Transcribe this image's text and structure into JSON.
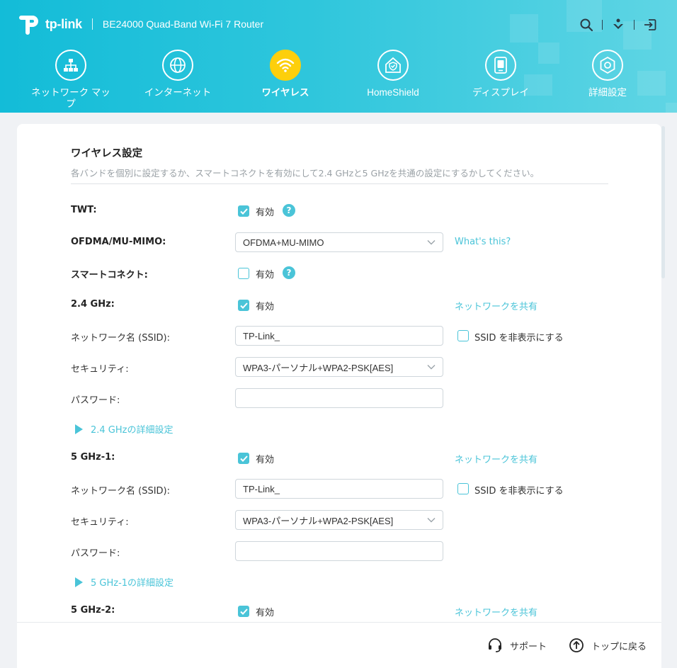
{
  "header": {
    "logo_text": "tp-link",
    "model": "BE24000 Quad-Band Wi-Fi 7 Router",
    "accent_color": "#13bcd8"
  },
  "nav": {
    "items": [
      {
        "label": "ネットワーク マップ",
        "icon": "network-map-icon"
      },
      {
        "label": "インターネット",
        "icon": "globe-icon"
      },
      {
        "label": "ワイヤレス",
        "icon": "wifi-icon",
        "active": true
      },
      {
        "label": "HomeShield",
        "icon": "homeshield-icon"
      },
      {
        "label": "ディスプレイ",
        "icon": "display-icon"
      },
      {
        "label": "詳細設定",
        "icon": "gear-icon"
      }
    ]
  },
  "section": {
    "title": "ワイヤレス設定",
    "description": "各バンドを個別に設定するか、スマートコネクトを有効にして2.4 GHzと5 GHzを共通の設定にするかしてください。"
  },
  "settings": {
    "twt": {
      "label": "TWT:",
      "checkbox_label": "有効",
      "checked": true
    },
    "ofdma": {
      "label": "OFDMA/MU-MIMO:",
      "value": "OFDMA+MU-MIMO",
      "link": "What's this?"
    },
    "smart_connect": {
      "label": "スマートコネクト:",
      "checkbox_label": "有効",
      "checked": false
    }
  },
  "bands": [
    {
      "label": "2.4 GHz:",
      "checkbox_label": "有効",
      "checked": true,
      "share_link": "ネットワークを共有",
      "ssid_label": "ネットワーク名 (SSID):",
      "ssid_value": "TP-Link_",
      "hide_ssid_label": "SSID を非表示にする",
      "security_label": "セキュリティ:",
      "security_value": "WPA3-パーソナル+WPA2-PSK[AES]",
      "password_label": "パスワード:",
      "password_value": "",
      "advanced_label": "2.4 GHzの詳細設定"
    },
    {
      "label": "5 GHz-1:",
      "checkbox_label": "有効",
      "checked": true,
      "share_link": "ネットワークを共有",
      "ssid_label": "ネットワーク名 (SSID):",
      "ssid_value": "TP-Link_",
      "hide_ssid_label": "SSID を非表示にする",
      "security_label": "セキュリティ:",
      "security_value": "WPA3-パーソナル+WPA2-PSK[AES]",
      "password_label": "パスワード:",
      "password_value": "",
      "advanced_label": "5 GHz-1の詳細設定"
    },
    {
      "label": "5 GHz-2:",
      "checkbox_label": "有効",
      "checked": true,
      "share_link": "ネットワークを共有"
    }
  ],
  "footer": {
    "support_label": "サポート",
    "top_label": "トップに戻る"
  }
}
